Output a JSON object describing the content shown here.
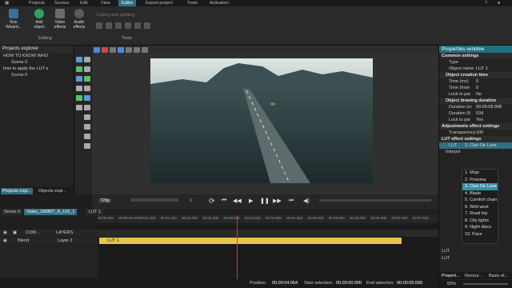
{
  "menu": [
    "Projects",
    "Scenes",
    "Edit",
    "View",
    "Editor",
    "Export project",
    "Tools",
    "Activation"
  ],
  "menu_active": "Editor",
  "top_right_icons": [
    "help-icon",
    "user-icon"
  ],
  "ribbon": {
    "run_wizard": "Run Wizard...",
    "add_object": "Add object",
    "video_effects": "Video effects",
    "audio_effects": "Audio effects",
    "editing_label": "Editing",
    "cutting_label": "Cutting and splitting",
    "tools_label": "Tools"
  },
  "explorer": {
    "title": "Projects explorer",
    "items": [
      {
        "label": "HOW TO KNOW WHO",
        "indent": 0
      },
      {
        "label": "Scene 0",
        "indent": 1
      },
      {
        "label": "how to apply the LUT e",
        "indent": 0
      },
      {
        "label": "Scene 0",
        "indent": 1
      }
    ],
    "tabs": [
      "Projects expl...",
      "Objects expl..."
    ]
  },
  "playback": {
    "zoom": "720p",
    "speed_marker": "1"
  },
  "timeline": {
    "tabs": [
      "Scene 0",
      "Video_180807_A_101_1",
      "LUT 1"
    ],
    "ticks": [
      "00:00.000",
      "00:00:00.500",
      "00:01.000",
      "00:01.500",
      "00:02.000",
      "00:02.500",
      "00:03.000",
      "00:03.500",
      "00:04.000",
      "00:04.500",
      "00:05.000",
      "00:05.500",
      "00:06.000",
      "00:06.500",
      "00:07.000",
      "00:07.500"
    ],
    "track1_label": "COM...",
    "track1_layers": "LAYERS",
    "track2_blend": "Blend",
    "track2_layer": "Layer 2",
    "clip_label": "LUT 1"
  },
  "status": {
    "position_label": "Position:",
    "position": "00:00:04.054",
    "start_label": "Start selection:",
    "start": "00:00:00.000",
    "end_label": "End selection:",
    "end": "00:00:00.000"
  },
  "properties": {
    "title": "Properties window",
    "common_settings": "Common settings",
    "type_label": "Type",
    "type_value": "",
    "object_name_label": "Object name",
    "object_name": "LUT 1",
    "creation_time": "Object creation time",
    "time_ms_label": "Time (ms)",
    "time_ms": "0",
    "time_frame_label": "Time (fram",
    "time_frame": "0",
    "lock_parent_label": "Lock to par",
    "lock_parent_1": "No",
    "drawing_duration": "Object drawing duration",
    "duration_ms_label": "Duration (m",
    "duration_ms": "00:00:08.908",
    "duration_f_label": "Duration (fi",
    "duration_f": "534",
    "lock_parent_2": "Yes",
    "adjustments": "Adjustments effect settings",
    "transparency_label": "Transparency",
    "transparency": "100",
    "lut_settings": "LUT effect settings",
    "lut_label": "LUT",
    "lut_value": "3. Clair De Lune",
    "interp_label": "Interpol",
    "lut_options": [
      "1. Mojo",
      "2. Proxima",
      "3. Clair De Lune",
      "4. Blade",
      "5. Comfort chain",
      "6. Wild west",
      "7. Road trip",
      "8. City lights",
      "9. Night discs",
      "10. Pace"
    ],
    "lut_selected_index": 2,
    "footer_lut_1": "LUT",
    "footer_lut_2": "LUT",
    "bottom_tabs": [
      "Propert...",
      "Resour...",
      "Basic ef..."
    ],
    "zoom": "65%"
  },
  "colors": {
    "accent": "#1f6f83",
    "clip": "#e5c54a",
    "playhead": "#d23b3b"
  }
}
